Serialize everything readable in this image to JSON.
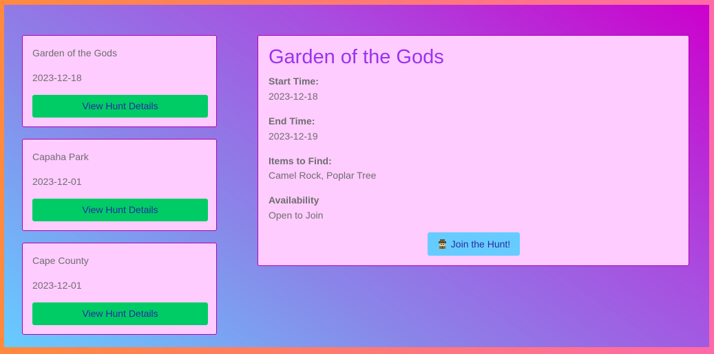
{
  "hunts": [
    {
      "name": "Garden of the Gods",
      "date": "2023-12-18",
      "button_label": "View Hunt Details"
    },
    {
      "name": "Capaha Park",
      "date": "2023-12-01",
      "button_label": "View Hunt Details"
    },
    {
      "name": "Cape County",
      "date": "2023-12-01",
      "button_label": "View Hunt Details"
    }
  ],
  "detail": {
    "title": "Garden of the Gods",
    "start_label": "Start Time:",
    "start_value": "2023-12-18",
    "end_label": "End Time:",
    "end_value": "2023-12-19",
    "items_label": "Items to Find:",
    "items_value": "Camel Rock, Poplar Tree",
    "availability_label": "Availability",
    "availability_value": "Open to Join",
    "join_button_label": "Join the Hunt!",
    "join_button_icon": "detective-icon"
  },
  "colors": {
    "card_background": "#ffccff",
    "card_border": "#b000b0",
    "view_button": "#00cc66",
    "join_button": "#66ccff",
    "title": "#9933ee"
  }
}
